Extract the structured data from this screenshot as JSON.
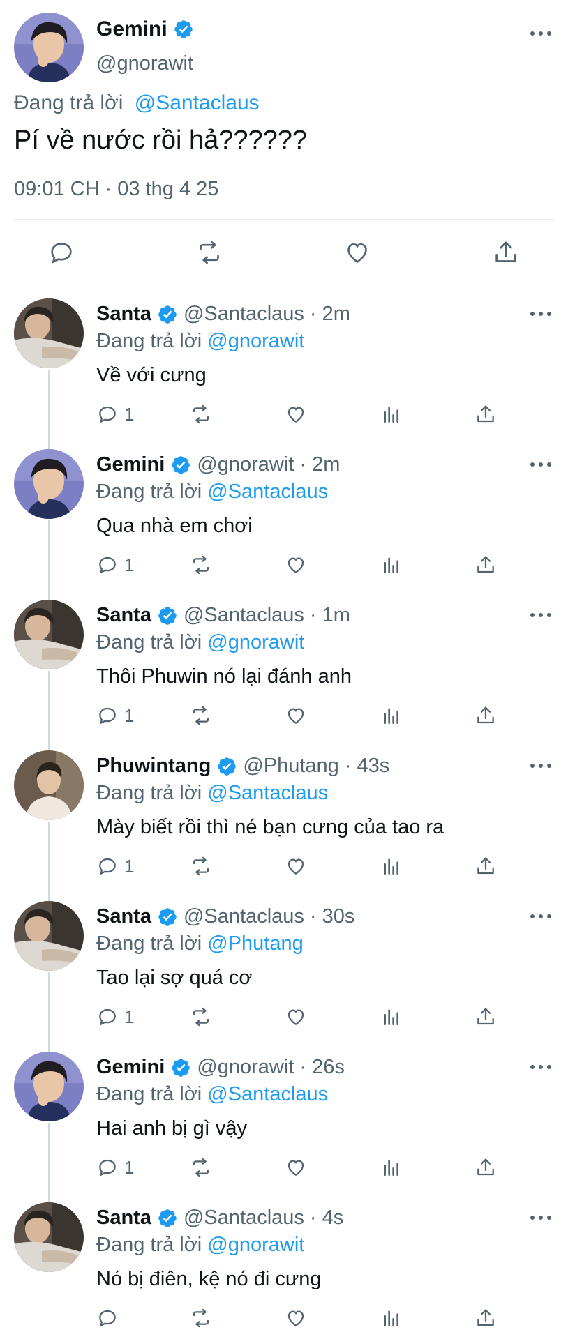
{
  "main_tweet": {
    "name": "Gemini",
    "handle": "@gnorawit",
    "reply_prefix": "Đang trả lời",
    "reply_to": "@Santaclaus",
    "text": "Pí về nước rồi hả??????",
    "timestamp": "09:01 CH · 03 thg 4 25",
    "actions": [
      "reply-icon",
      "retweet-icon",
      "like-icon",
      "share-icon"
    ]
  },
  "replies": [
    {
      "name": "Santa",
      "handle": "@Santaclaus",
      "time": "· 2m",
      "reply_prefix": "Đang trả lời",
      "reply_to": "@gnorawit",
      "text": "Về với cưng",
      "reply_count": "1"
    },
    {
      "name": "Gemini",
      "handle": "@gnorawit",
      "time": "· 2m",
      "reply_prefix": "Đang trả lời",
      "reply_to": "@Santaclaus",
      "text": "Qua nhà em chơi",
      "reply_count": "1"
    },
    {
      "name": "Santa",
      "handle": "@Santaclaus",
      "time": "· 1m",
      "reply_prefix": "Đang trả lời",
      "reply_to": "@gnorawit",
      "text": "Thôi Phuwin nó lại đánh anh",
      "reply_count": "1"
    },
    {
      "name": "Phuwintang",
      "handle": "@Phutang",
      "time": "· 43s",
      "reply_prefix": "Đang trả lời",
      "reply_to": "@Santaclaus",
      "text": "Mày biết rồi thì né bạn cưng của tao ra",
      "reply_count": "1"
    },
    {
      "name": "Santa",
      "handle": "@Santaclaus",
      "time": "· 30s",
      "reply_prefix": "Đang trả lời",
      "reply_to": "@Phutang",
      "text": "Tao lại sợ quá cơ",
      "reply_count": "1"
    },
    {
      "name": "Gemini",
      "handle": "@gnorawit",
      "time": "· 26s",
      "reply_prefix": "Đang trả lời",
      "reply_to": "@Santaclaus",
      "text": "Hai anh bị gì vậy",
      "reply_count": "1"
    },
    {
      "name": "Santa",
      "handle": "@Santaclaus",
      "time": "· 4s",
      "reply_prefix": "Đang trả lời",
      "reply_to": "@gnorawit",
      "text": "Nó bị điên, kệ nó đi cưng",
      "reply_count": ""
    }
  ],
  "colors": {
    "accent": "#1d9bf0",
    "secondary_text": "#536471",
    "divider": "#e6ecf0",
    "thread_line": "#cfd9de"
  }
}
